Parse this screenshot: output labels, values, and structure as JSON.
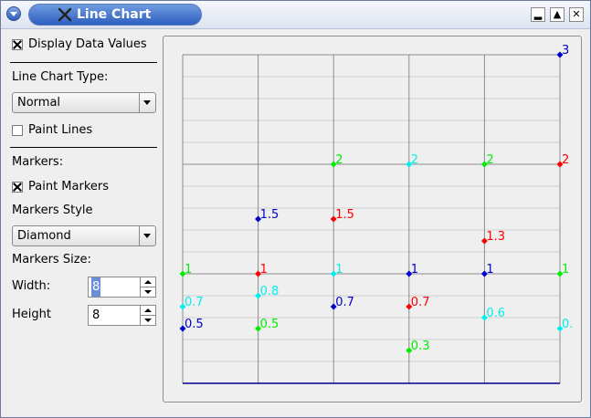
{
  "window": {
    "title": "Line Chart",
    "colors": {
      "title_active": "#2d5fbf",
      "bg": "#efefef"
    }
  },
  "controls": {
    "display_values": {
      "label": "Display Data Values",
      "checked": true
    },
    "line_chart_type": {
      "label": "Line Chart Type:",
      "selected": "Normal"
    },
    "paint_lines": {
      "label": "Paint Lines",
      "checked": false
    },
    "markers_heading": "Markers:",
    "paint_markers": {
      "label": "Paint Markers",
      "checked": true
    },
    "markers_style": {
      "label": "Markers Style",
      "selected": "Diamond"
    },
    "markers_size": "Markers Size:",
    "width": {
      "label": "Width:",
      "value": "8"
    },
    "height": {
      "label": "Height",
      "value": "8"
    }
  },
  "chart_data": {
    "type": "line",
    "ylim": [
      0,
      3
    ],
    "grid": true,
    "lines": false,
    "marker": "diamond",
    "x": [
      0,
      1,
      2,
      3,
      4,
      5
    ],
    "series": [
      {
        "color": "#00ee00",
        "values": [
          1,
          0.5,
          2,
          0.3,
          2,
          1
        ],
        "labels": [
          "1",
          "0.5",
          "2",
          "0.3",
          "2",
          "1"
        ]
      },
      {
        "color": "#ff0000",
        "values": [
          null,
          1,
          1.5,
          0.7,
          1.3,
          2
        ],
        "labels": [
          "",
          "1",
          "1.5",
          "0.7",
          "1.3",
          "2"
        ]
      },
      {
        "color": "#0000cc",
        "values": [
          0.5,
          1.5,
          0.7,
          1,
          1,
          3
        ],
        "labels": [
          "0.5",
          "1.5",
          "0.7",
          "1",
          "1",
          "3"
        ]
      },
      {
        "color": "#00eeee",
        "values": [
          0.7,
          0.8,
          1,
          2,
          0.6,
          0.5
        ],
        "labels": [
          "0.7",
          "0.8",
          "1",
          "2",
          "0.6",
          "0."
        ]
      }
    ]
  }
}
